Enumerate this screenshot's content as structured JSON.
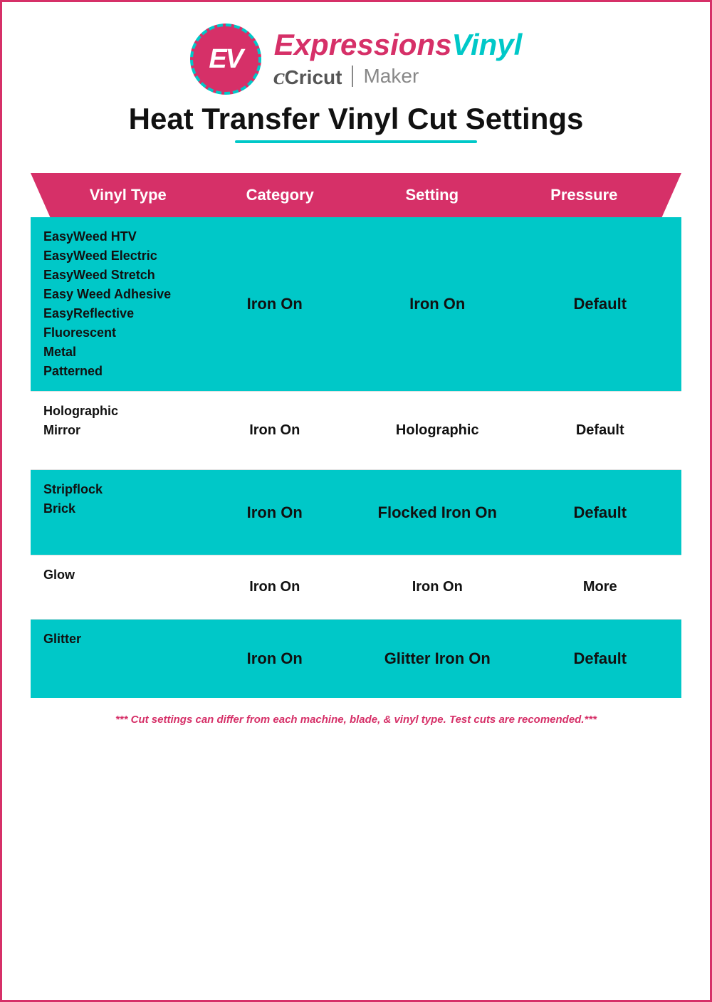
{
  "header": {
    "ev_initials": "EV",
    "brand_expressions": "Expressions",
    "brand_vinyl": "Vinyl",
    "cricut_label": "Cricut",
    "maker_label": "Maker",
    "title": "Heat Transfer Vinyl Cut Settings"
  },
  "table": {
    "columns": [
      "Vinyl Type",
      "Category",
      "Setting",
      "Pressure"
    ],
    "rows": [
      {
        "id": "row1",
        "style": "teal",
        "vinyl_types": [
          "EasyWeed HTV",
          "EasyWeed Electric",
          "EasyWeed Stretch",
          "Easy Weed Adhesive",
          "EasyReflective",
          "Fluorescent",
          "Metal",
          "Patterned"
        ],
        "category": "Iron On",
        "setting": "Iron On",
        "pressure": "Default"
      },
      {
        "id": "row2",
        "style": "white",
        "vinyl_types": [
          "Holographic",
          "Mirror"
        ],
        "category": "Iron On",
        "setting": "Holographic",
        "pressure": "Default"
      },
      {
        "id": "row3",
        "style": "teal",
        "vinyl_types": [
          "Stripflock",
          "Brick"
        ],
        "category": "Iron On",
        "setting": "Flocked Iron On",
        "pressure": "Default"
      },
      {
        "id": "row4",
        "style": "white",
        "vinyl_types": [
          "Glow"
        ],
        "category": "Iron On",
        "setting": "Iron On",
        "pressure": "More"
      },
      {
        "id": "row5",
        "style": "teal",
        "vinyl_types": [
          "Glitter"
        ],
        "category": "Iron On",
        "setting": "Glitter Iron On",
        "pressure": "Default"
      }
    ],
    "footnote": "*** Cut settings can differ from each machine, blade, & vinyl type. Test cuts are recomended.***"
  }
}
